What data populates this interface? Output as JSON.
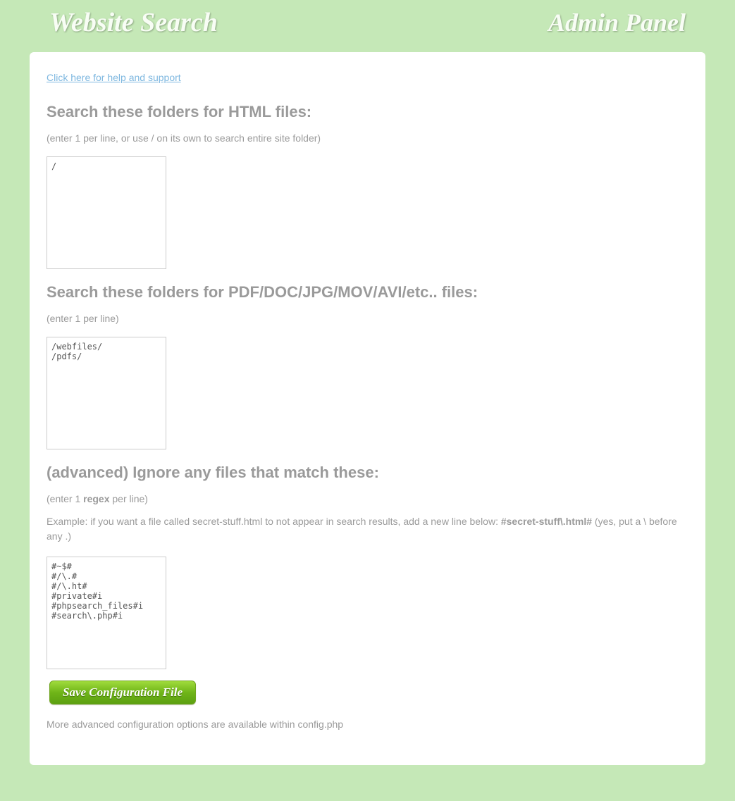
{
  "header": {
    "title_left": "Website Search",
    "title_right": "Admin Panel"
  },
  "help_link": "Click here for help and support",
  "section1": {
    "heading": "Search these folders for HTML files:",
    "hint": "(enter 1 per line, or use / on its own to search entire site folder)",
    "value": "/"
  },
  "section2": {
    "heading": "Search these folders for PDF/DOC/JPG/MOV/AVI/etc.. files:",
    "hint": "(enter 1 per line)",
    "value": "/webfiles/\n/pdfs/"
  },
  "section3": {
    "heading": "(advanced) Ignore any files that match these:",
    "hint_pre": "(enter 1 ",
    "hint_bold": "regex",
    "hint_post": " per line)",
    "example_pre": "Example: if you want a file called secret-stuff.html to not appear in search results, add a new line below: ",
    "example_bold": "#secret-stuff\\.html#",
    "example_post": " (yes, put a \\ before any .)",
    "value": "#~$#\n#/\\.#\n#/\\.ht#\n#private#i\n#phpsearch_files#i\n#search\\.php#i"
  },
  "save_button": "Save Configuration File",
  "footer_note": "More advanced configuration options are available within config.php"
}
